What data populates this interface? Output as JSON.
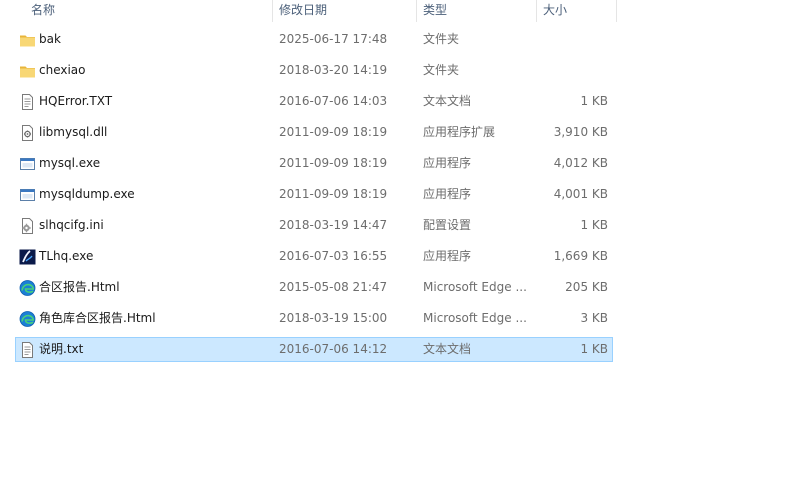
{
  "columns": {
    "name": "名称",
    "date": "修改日期",
    "type": "类型",
    "size": "大小"
  },
  "files": [
    {
      "name": "bak",
      "date": "2025-06-17 17:48",
      "type": "文件夹",
      "size": "",
      "icon": "folder-icon"
    },
    {
      "name": "chexiao",
      "date": "2018-03-20 14:19",
      "type": "文件夹",
      "size": "",
      "icon": "folder-icon"
    },
    {
      "name": "HQError.TXT",
      "date": "2016-07-06 14:03",
      "type": "文本文档",
      "size": "1 KB",
      "icon": "text-file-icon"
    },
    {
      "name": "libmysql.dll",
      "date": "2011-09-09 18:19",
      "type": "应用程序扩展",
      "size": "3,910 KB",
      "icon": "dll-file-icon"
    },
    {
      "name": "mysql.exe",
      "date": "2011-09-09 18:19",
      "type": "应用程序",
      "size": "4,012 KB",
      "icon": "exe-window-icon"
    },
    {
      "name": "mysqldump.exe",
      "date": "2011-09-09 18:19",
      "type": "应用程序",
      "size": "4,001 KB",
      "icon": "exe-window-icon"
    },
    {
      "name": "slhqcifg.ini",
      "date": "2018-03-19 14:47",
      "type": "配置设置",
      "size": "1 KB",
      "icon": "ini-settings-icon"
    },
    {
      "name": "TLhq.exe",
      "date": "2016-07-03 16:55",
      "type": "应用程序",
      "size": "1,669 KB",
      "icon": "tlhq-app-icon"
    },
    {
      "name": "合区报告.Html",
      "date": "2015-05-08 21:47",
      "type": "Microsoft Edge ...",
      "size": "205 KB",
      "icon": "edge-icon"
    },
    {
      "name": "角色库合区报告.Html",
      "date": "2018-03-19 15:00",
      "type": "Microsoft Edge ...",
      "size": "3 KB",
      "icon": "edge-icon"
    },
    {
      "name": "说明.txt",
      "date": "2016-07-06 14:12",
      "type": "文本文档",
      "size": "1 KB",
      "icon": "text-file-icon",
      "selected": true
    }
  ],
  "colors": {
    "header_text": "#4c607a",
    "selection_bg": "#cce8ff",
    "selection_border": "#99d1ff",
    "folder": "#f8d775",
    "secondary_text": "#6d6d6d"
  }
}
